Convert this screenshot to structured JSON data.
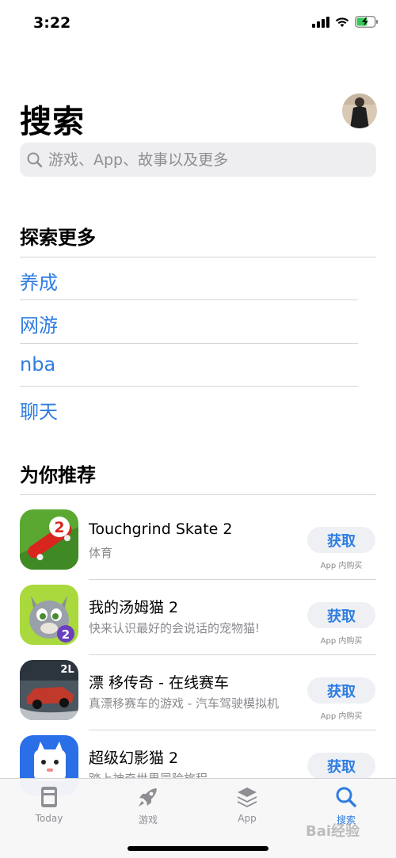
{
  "status_bar": {
    "time": "3:22"
  },
  "header": {
    "title": "搜索"
  },
  "search": {
    "placeholder": "游戏、App、故事以及更多"
  },
  "explore": {
    "title": "探索更多",
    "items": [
      "养成",
      "网游",
      "nba",
      "聊天"
    ]
  },
  "recommend": {
    "title": "为你推荐",
    "apps": [
      {
        "name": "Touchgrind Skate 2",
        "subtitle": "体育",
        "button": "获取",
        "note": "App 内购买"
      },
      {
        "name": "我的汤姆猫 2",
        "subtitle": "快来认识最好的会说话的宠物猫!",
        "button": "获取",
        "note": "App 内购买"
      },
      {
        "name": "漂 移传奇 - 在线赛车",
        "subtitle": "真漂移赛车的游戏 - 汽车驾驶模拟机",
        "button": "获取",
        "note": "App 内购买"
      },
      {
        "name": "超级幻影猫 2",
        "subtitle": "踏上神奇世界冒险旅程",
        "button": "获取",
        "note": ""
      }
    ]
  },
  "tab_bar": {
    "tabs": [
      {
        "label": "Today",
        "icon": "today-icon"
      },
      {
        "label": "游戏",
        "icon": "rocket-icon"
      },
      {
        "label": "App",
        "icon": "layers-icon"
      },
      {
        "label": "搜索",
        "icon": "search-icon"
      }
    ],
    "active": "搜索"
  },
  "watermark": "Bai经验",
  "colors": {
    "accent": "#2f7de1",
    "search_bg": "#eeeef0",
    "button_bg": "#eef0f4"
  }
}
